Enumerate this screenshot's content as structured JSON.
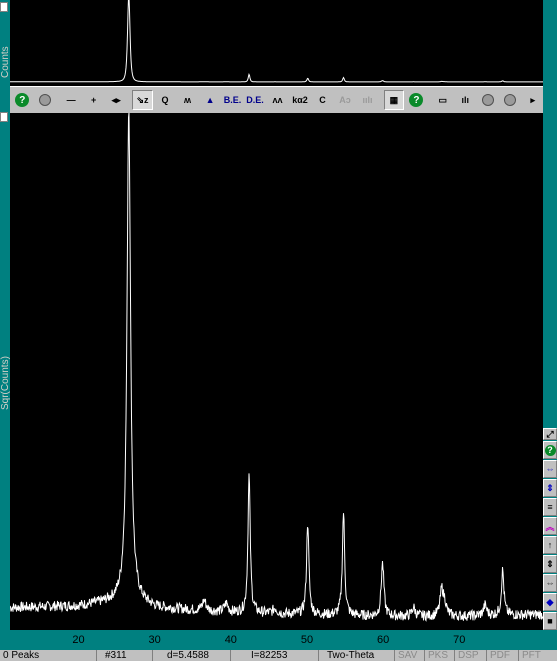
{
  "top_panel": {
    "ylabel": "Counts"
  },
  "main_panel": {
    "ylabel": "Sqr(Counts)"
  },
  "toolbar": {
    "buttons": [
      {
        "name": "help-green-icon",
        "label": "?"
      },
      {
        "name": "grey-circle-icon",
        "label": ""
      },
      {
        "name": "minus-icon",
        "label": "—"
      },
      {
        "name": "plus-icon",
        "label": "+"
      },
      {
        "name": "pan-arrows-icon",
        "label": "◂▸"
      },
      {
        "name": "zoom-select-icon",
        "label": "⇘z"
      },
      {
        "name": "magnifier-icon",
        "label": "Q"
      },
      {
        "name": "peak-marker-icon",
        "label": "ʍ"
      },
      {
        "name": "peak-fill-icon",
        "label": "▲"
      },
      {
        "name": "be-icon",
        "label": "B.E."
      },
      {
        "name": "de-icon",
        "label": "D.E."
      },
      {
        "name": "profile-icon",
        "label": "ʌʌ"
      },
      {
        "name": "ka2-icon",
        "label": "kα2"
      },
      {
        "name": "c-icon",
        "label": "C"
      },
      {
        "name": "a-dim-icon",
        "label": "Aↄ"
      },
      {
        "name": "bars-dim-icon",
        "label": "ıılı"
      },
      {
        "name": "grid-icon",
        "label": "▦"
      },
      {
        "name": "help-green-2-icon",
        "label": "?"
      },
      {
        "name": "monitor-icon",
        "label": "▭"
      },
      {
        "name": "histogram-icon",
        "label": "ılı"
      },
      {
        "name": "target-icon",
        "label": ""
      },
      {
        "name": "stop-icon",
        "label": ""
      },
      {
        "name": "next-icon",
        "label": "▸"
      }
    ]
  },
  "right_toolbar": {
    "buttons": [
      {
        "name": "resize-icon",
        "label": "⤢"
      },
      {
        "name": "help-icon",
        "label": "?"
      },
      {
        "name": "expand-h-icon",
        "label": "⇔"
      },
      {
        "name": "expand-v-icon",
        "label": "⇕"
      },
      {
        "name": "lines-icon",
        "label": "≡"
      },
      {
        "name": "up-chevron-icon",
        "label": "︽"
      },
      {
        "name": "up-arrow-icon",
        "label": "↑"
      },
      {
        "name": "updown-icon",
        "label": "⇕"
      },
      {
        "name": "leftright-icon",
        "label": "⇔"
      },
      {
        "name": "diamond-icon",
        "label": "◆"
      },
      {
        "name": "dark-icon",
        "label": "■"
      }
    ]
  },
  "status_bar": {
    "peaks": "0 Peaks",
    "scan": "#311",
    "d_value": "d=5.4588",
    "intensity": "I=82253",
    "axis_mode": "Two-Theta",
    "sav": "SAV",
    "pks": "PKS",
    "dsp": "DSP",
    "pdf": "PDF",
    "pft": "PFT"
  },
  "chart_data": {
    "type": "line",
    "xlabel": "",
    "ylabel": "Sqr(Counts)",
    "xlim": [
      11,
      81
    ],
    "ylim": [
      0,
      300
    ],
    "x_ticks": [
      20,
      30,
      40,
      50,
      60,
      70
    ],
    "grid": false,
    "peaks": [
      {
        "x": 26.6,
        "y": 287,
        "w": 0.28
      },
      {
        "x": 36.5,
        "y": 6,
        "w": 0.3
      },
      {
        "x": 39.4,
        "y": 5,
        "w": 0.3
      },
      {
        "x": 42.4,
        "y": 80,
        "w": 0.18
      },
      {
        "x": 45.8,
        "y": 3,
        "w": 0.3
      },
      {
        "x": 50.1,
        "y": 54,
        "w": 0.18
      },
      {
        "x": 54.8,
        "y": 60,
        "w": 0.18
      },
      {
        "x": 59.9,
        "y": 23,
        "w": 0.2
      },
      {
        "x": 60.0,
        "y": 9,
        "w": 0.2
      },
      {
        "x": 64.0,
        "y": 5,
        "w": 0.25
      },
      {
        "x": 67.7,
        "y": 15,
        "w": 0.25
      },
      {
        "x": 68.1,
        "y": 7,
        "w": 0.25
      },
      {
        "x": 73.4,
        "y": 6,
        "w": 0.25
      },
      {
        "x": 75.7,
        "y": 26,
        "w": 0.2
      }
    ],
    "baseline": [
      {
        "x": 11,
        "y": 13
      },
      {
        "x": 20,
        "y": 14
      },
      {
        "x": 24,
        "y": 16
      },
      {
        "x": 27,
        "y": 17
      },
      {
        "x": 30,
        "y": 13
      },
      {
        "x": 40,
        "y": 10
      },
      {
        "x": 50,
        "y": 9
      },
      {
        "x": 60,
        "y": 8
      },
      {
        "x": 70,
        "y": 8
      },
      {
        "x": 81,
        "y": 9
      }
    ],
    "top_panel_ylim": [
      0,
      82253
    ]
  }
}
